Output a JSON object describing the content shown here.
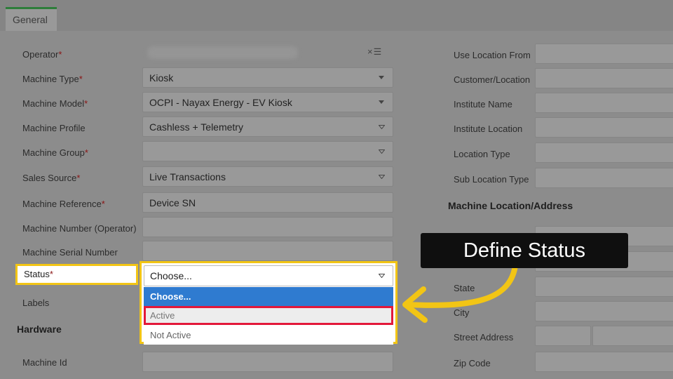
{
  "tabs": {
    "general": "General"
  },
  "left": {
    "operator": {
      "label": "Operator",
      "icons": "×☰"
    },
    "machine_type": {
      "label": "Machine Type",
      "value": "Kiosk"
    },
    "machine_model": {
      "label": "Machine Model",
      "value": "OCPI - Nayax Energy - EV Kiosk"
    },
    "machine_profile": {
      "label": "Machine Profile",
      "value": "Cashless + Telemetry"
    },
    "machine_group": {
      "label": "Machine Group",
      "value": ""
    },
    "sales_source": {
      "label": "Sales Source",
      "value": "Live Transactions"
    },
    "machine_reference": {
      "label": "Machine Reference",
      "value": "Device SN"
    },
    "machine_number": {
      "label": "Machine Number (Operator)",
      "value": ""
    },
    "machine_serial": {
      "label": "Machine Serial Number",
      "value": ""
    },
    "status": {
      "label": "Status",
      "value": "Choose...",
      "options": [
        "Choose...",
        "Active",
        "Not Active"
      ]
    },
    "labels": {
      "label": "Labels"
    },
    "hardware_title": "Hardware",
    "machine_id": {
      "label": "Machine Id"
    },
    "required_mark": "*"
  },
  "right": {
    "use_location_from": "Use Location From",
    "customer_location": "Customer/Location",
    "institute_name": "Institute Name",
    "institute_location": "Institute Location",
    "location_type": "Location Type",
    "sub_location_type": "Sub Location Type",
    "address_title": "Machine Location/Address",
    "state": "State",
    "city": "City",
    "street_address": "Street Address",
    "zip_code": "Zip Code"
  },
  "callout": {
    "text": "Define Status"
  },
  "colors": {
    "highlight": "#f2c515",
    "selection": "#e3183a",
    "option_active": "#2f7bd0",
    "tab_accent": "#2d7d3a"
  }
}
